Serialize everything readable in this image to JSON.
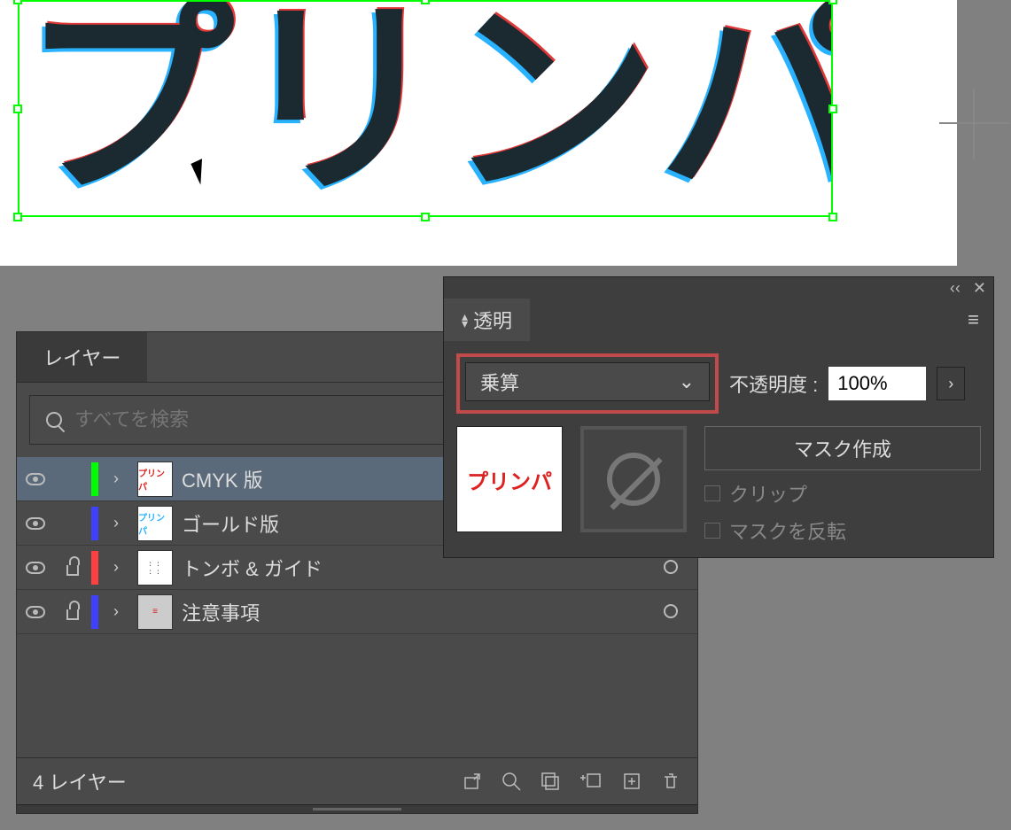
{
  "layers_panel": {
    "tab_label": "レイヤー",
    "search_placeholder": "すべてを検索",
    "items": [
      {
        "name": "CMYK 版",
        "color": "green",
        "active": true,
        "locked": false,
        "target": false
      },
      {
        "name": "ゴールド版",
        "color": "blue",
        "active": false,
        "locked": false,
        "target": false
      },
      {
        "name": "トンボ & ガイド",
        "color": "red",
        "active": false,
        "locked": true,
        "target": true
      },
      {
        "name": "注意事項",
        "color": "blue",
        "active": false,
        "locked": true,
        "target": true
      }
    ],
    "footer_count": "4 レイヤー"
  },
  "transparency_panel": {
    "tab_label": "透明",
    "blend_mode": "乗算",
    "opacity_label": "不透明度 :",
    "opacity_value": "100%",
    "make_mask_label": "マスク作成",
    "clip_label": "クリップ",
    "invert_label": "マスクを反転",
    "thumb_text": "プリンパ"
  },
  "artwork_text": "プリンパ"
}
